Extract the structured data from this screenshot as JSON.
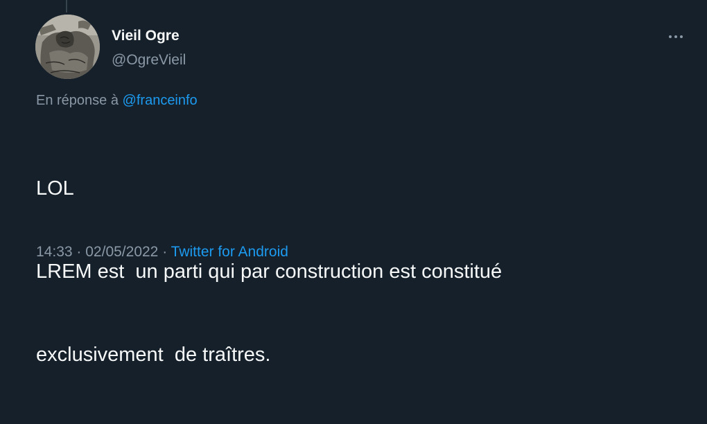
{
  "author": {
    "display_name": "Vieil Ogre",
    "handle": "@OgreVieil"
  },
  "reply": {
    "prefix": "En réponse à",
    "mention": "@franceinfo"
  },
  "tweet": {
    "line1": "LOL",
    "line2": "LREM est  un parti qui par construction est constitué",
    "line3": "exclusivement  de traîtres."
  },
  "meta": {
    "time": "14:33",
    "date": "02/05/2022",
    "separator": "·",
    "source": "Twitter for Android"
  },
  "icons": {
    "more": "more-horizontal-icon"
  },
  "colors": {
    "background": "#15202b",
    "text": "#f7f9f9",
    "secondary": "#8b98a5",
    "accent": "#1d9bf0"
  }
}
